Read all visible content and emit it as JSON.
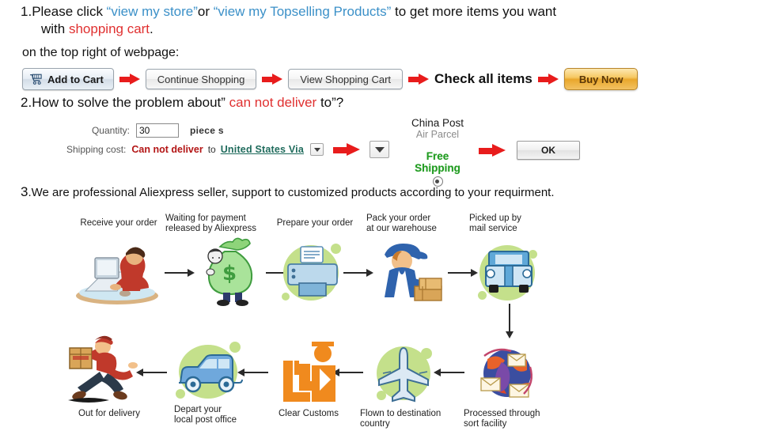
{
  "section1": {
    "number": "1.",
    "text_before": "Please click ",
    "link1": "“view my store”",
    "text_mid": "or ",
    "link2": "“view my Topselling Products”",
    "text_after": " to get  more items you want",
    "line2_prefix": "with ",
    "line2_highlight": "shopping cart",
    "line2_suffix": ".",
    "line3": "on the top right of webpage:",
    "buttons": {
      "add_to_cart": "Add to Cart",
      "continue_shopping": "Continue Shopping",
      "view_shopping_cart": "View Shopping Cart",
      "check_all_items": "Check all items",
      "buy_now": "Buy Now"
    }
  },
  "section2": {
    "number": "2.",
    "heading_before": "How to solve the problem about” ",
    "heading_highlight": "can not deliver",
    "heading_after": " to”?",
    "quantity_label": "Quantity:",
    "quantity_value": "30",
    "quantity_unit": "piece s",
    "shipping_label": "Shipping cost:",
    "shipping_status": "Can not deliver",
    "shipping_to": "to",
    "shipping_country": "United States Via",
    "carrier_line1": "China Post",
    "carrier_line2": "Air Parcel",
    "free_line1": "Free",
    "free_line2": "Shipping",
    "ok_button": "OK"
  },
  "section3": {
    "number": "3",
    "heading": ".We are professional Aliexpress seller, support to customized products according to your requirment."
  },
  "flow": {
    "steps": [
      {
        "id": "receive-order",
        "label": "Receive your order",
        "icon": "person-at-computer-icon"
      },
      {
        "id": "waiting-payment",
        "label": "Waiting for payment\nreleased by Aliexpress",
        "icon": "money-bag-icon"
      },
      {
        "id": "prepare-order",
        "label": "Prepare your order",
        "icon": "printer-icon"
      },
      {
        "id": "pack-order",
        "label": "Pack your order\nat our warehouse",
        "icon": "worker-with-boxes-icon"
      },
      {
        "id": "picked-up",
        "label": "Picked up by\nmail service",
        "icon": "mail-truck-icon"
      },
      {
        "id": "sort-facility",
        "label": "Processed through\nsort facility",
        "icon": "globe-envelopes-icon"
      },
      {
        "id": "flown-destination",
        "label": "Flown to destination\ncountry",
        "icon": "airplane-icon"
      },
      {
        "id": "clear-customs",
        "label": "Clear Customs",
        "icon": "customs-officer-icon"
      },
      {
        "id": "depart-post",
        "label": "Depart your\nlocal post office",
        "icon": "delivery-van-icon"
      },
      {
        "id": "out-for-delivery",
        "label": "Out for delivery",
        "icon": "running-courier-icon"
      }
    ]
  },
  "colors": {
    "link_blue": "#3b90c8",
    "alert_red": "#e03030",
    "arrow_red": "#e81c1c",
    "free_green": "#1f9b1f",
    "country_teal": "#1f6b5c",
    "blob_green": "#c4e08b",
    "buy_now_gold": "#e9a72c"
  }
}
